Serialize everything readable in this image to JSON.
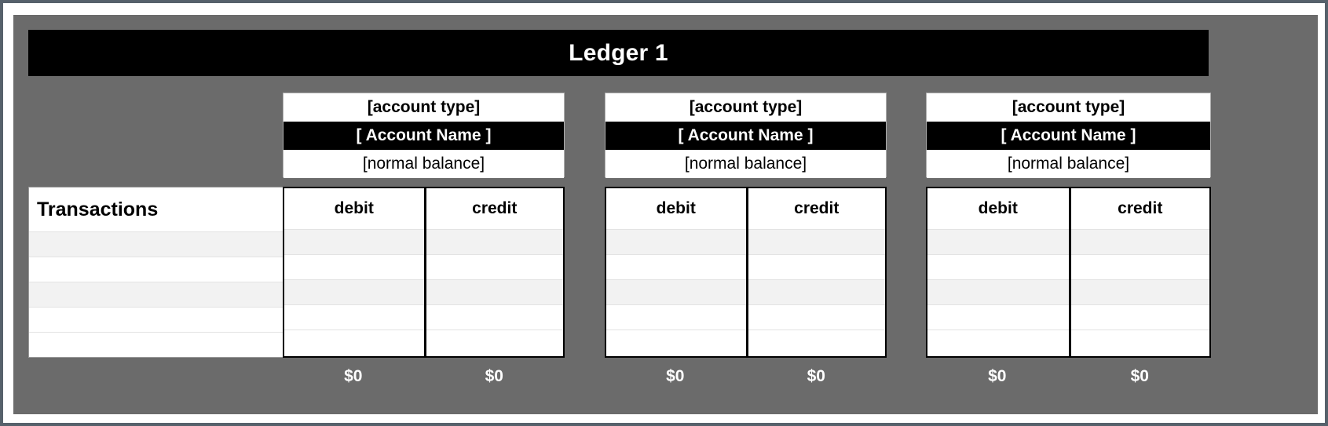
{
  "ledger": {
    "title": "Ledger 1",
    "transactions_label": "Transactions",
    "accounts": [
      {
        "account_type": "[account type]",
        "account_name": "[ Account Name ]",
        "normal_balance": "[normal balance]",
        "debit_header": "debit",
        "credit_header": "credit",
        "debit_total": "$0",
        "credit_total": "$0",
        "debit_entries": [
          "",
          "",
          "",
          "",
          ""
        ],
        "credit_entries": [
          "",
          "",
          "",
          "",
          ""
        ]
      },
      {
        "account_type": "[account type]",
        "account_name": "[ Account Name ]",
        "normal_balance": "[normal balance]",
        "debit_header": "debit",
        "credit_header": "credit",
        "debit_total": "$0",
        "credit_total": "$0",
        "debit_entries": [
          "",
          "",
          "",
          "",
          ""
        ],
        "credit_entries": [
          "",
          "",
          "",
          "",
          ""
        ]
      },
      {
        "account_type": "[account type]",
        "account_name": "[ Account Name ]",
        "normal_balance": "[normal balance]",
        "debit_header": "debit",
        "credit_header": "credit",
        "debit_total": "$0",
        "credit_total": "$0",
        "debit_entries": [
          "",
          "",
          "",
          "",
          ""
        ],
        "credit_entries": [
          "",
          "",
          "",
          "",
          ""
        ]
      }
    ],
    "transaction_rows": [
      "",
      "",
      "",
      "",
      ""
    ]
  },
  "colors": {
    "canvas": "#6b6b6b",
    "banner": "#000000",
    "banner_text": "#ffffff",
    "account_name_bg": "#000000",
    "row_shade": "#f2f2f2",
    "outer_frame": "#56616b"
  }
}
